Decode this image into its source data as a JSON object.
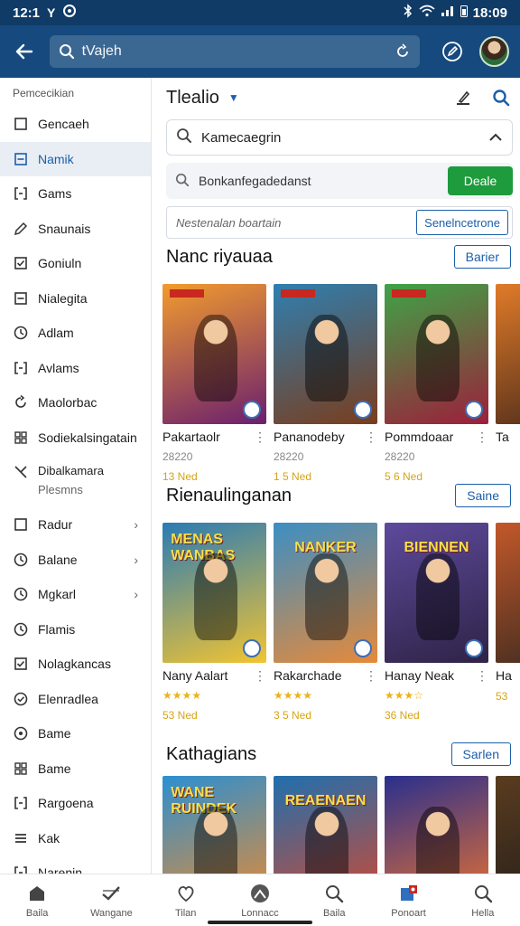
{
  "status_bar": {
    "time": "12:1",
    "carrier_icons": "Y",
    "clock": "18:09"
  },
  "app_bar": {
    "search_text": "tVajeh"
  },
  "sidebar": {
    "section_title": "Pemcecikian",
    "items": [
      {
        "label": "Gencaeh",
        "icon": "square-icon"
      },
      {
        "label": "Namik",
        "icon": "minus-square-icon",
        "active": true
      },
      {
        "label": "Gams",
        "icon": "bracket-icon"
      },
      {
        "label": "Snaunais",
        "icon": "pen-icon"
      },
      {
        "label": "Goniuln",
        "icon": "check-square-icon"
      },
      {
        "label": "Nialegita",
        "icon": "minus-square-icon"
      },
      {
        "label": "Adlam",
        "icon": "clock-icon"
      },
      {
        "label": "Avlams",
        "icon": "bracket-icon"
      },
      {
        "label": "Maolorbac",
        "icon": "refresh-icon"
      },
      {
        "label": "Sodiekalsingatain",
        "icon": "grid-icon"
      }
    ],
    "two_line": {
      "label": "Dibalkamara",
      "sub": "Plesmns"
    },
    "items2": [
      {
        "label": "Radur",
        "icon": "square-icon",
        "chevron": true
      },
      {
        "label": "Balane",
        "icon": "clock-icon",
        "chevron": true
      },
      {
        "label": "Mgkarl",
        "icon": "clock-icon",
        "chevron": true
      },
      {
        "label": "Flamis",
        "icon": "clock-icon"
      },
      {
        "label": "Nolagkancas",
        "icon": "check-square-icon"
      },
      {
        "label": "Elenradlea",
        "icon": "check-circle-icon"
      },
      {
        "label": "Bame",
        "icon": "circle-icon"
      },
      {
        "label": "Bame",
        "icon": "grid-icon"
      },
      {
        "label": "Rargoena",
        "icon": "bracket-icon"
      },
      {
        "label": "Kak",
        "icon": "list-icon"
      },
      {
        "label": "Narenin",
        "icon": "bracket-icon"
      }
    ]
  },
  "main": {
    "title": "Tlealio",
    "filter": "Kamecaegrin",
    "sub_search": "Bonkanfegadedanst",
    "go_label": "Deale",
    "input_placeholder": "Nestenalan boartain",
    "input_button": "Senelncetrone",
    "sections": [
      {
        "title": "Nanc riyauaa",
        "button": "Barier",
        "cards": [
          {
            "name": "Pakartaolr",
            "line2": "28220",
            "line3": "13 Ned"
          },
          {
            "name": "Pananodeby",
            "line2": "28220",
            "line3": "1 5 Ned"
          },
          {
            "name": "Pommdoaar",
            "line2": "28220",
            "line3": "5 6 Ned"
          },
          {
            "name": "Ta",
            "line2": "",
            "line3": ""
          }
        ]
      },
      {
        "title": "Rienaulinganan",
        "button": "Saine",
        "cards": [
          {
            "name": "Nany Aalart",
            "logo": "MENAS WANBAS",
            "stars": "★★★★",
            "line3": "53 Ned"
          },
          {
            "name": "Rakarchade",
            "logo": "NANKER",
            "stars": "★★★★",
            "line3": "3 5 Ned"
          },
          {
            "name": "Hanay Neak",
            "logo": "BIENNEN",
            "stars": "★★★☆",
            "line3": "36 Ned"
          },
          {
            "name": "Ha",
            "logo": "",
            "stars": "",
            "line3": "53"
          }
        ]
      },
      {
        "title": "Kathagians",
        "button": "Sarlen",
        "cards": [
          {
            "logo": "WANE RUINDEK"
          },
          {
            "logo": "REAENAEN"
          },
          {
            "logo": ""
          },
          {
            "logo": ""
          }
        ]
      }
    ]
  },
  "bottom_nav": [
    {
      "label": "Baila",
      "icon": "home-icon"
    },
    {
      "label": "Wangane",
      "icon": "check-icon"
    },
    {
      "label": "Tilan",
      "icon": "heart-icon"
    },
    {
      "label": "Lonnacc",
      "icon": "profile-icon"
    },
    {
      "label": "Baila",
      "icon": "search-icon"
    },
    {
      "label": "Ponoart",
      "icon": "cart-icon"
    },
    {
      "label": "Hella",
      "icon": "search-icon"
    }
  ],
  "colors": {
    "brand": "#164a7e",
    "accent": "#1b5fa8",
    "go": "#1e9b3c",
    "rating": "#e8b41b"
  }
}
